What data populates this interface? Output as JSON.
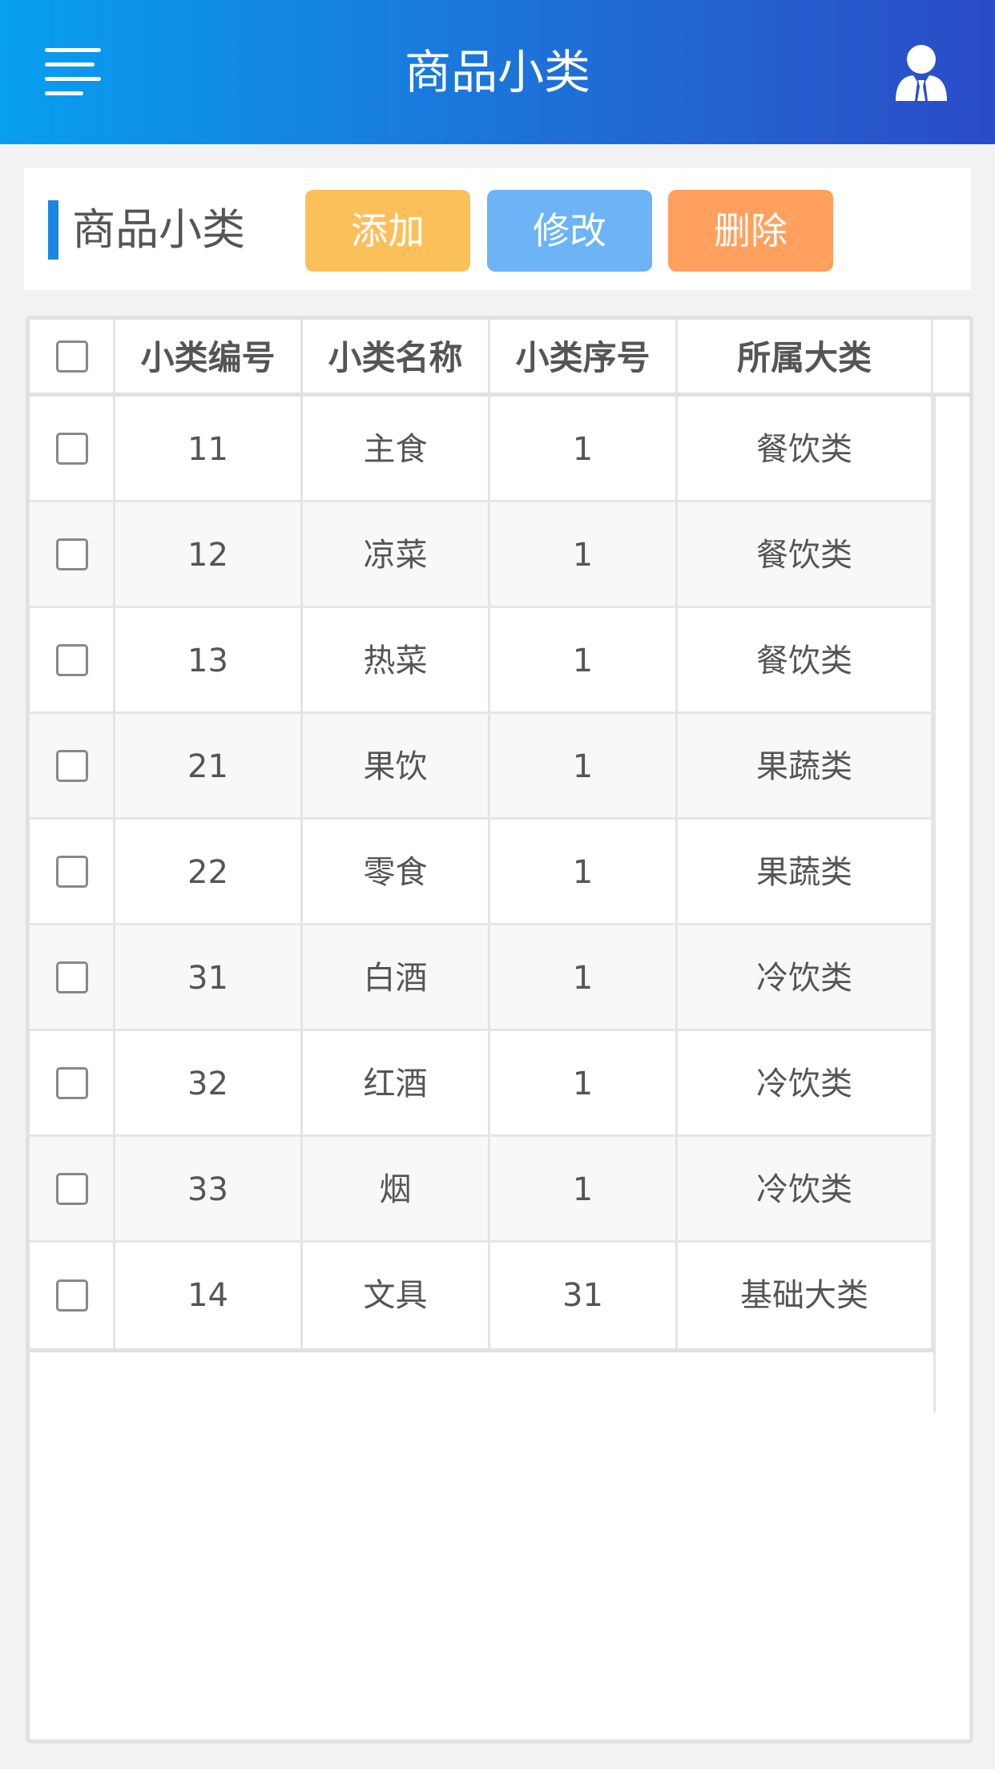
{
  "header": {
    "title": "商品小类",
    "menu_icon": "hamburger-menu-icon",
    "user_icon": "user-profile-icon",
    "gradient": [
      "#079ff0",
      "#2a4cc6"
    ]
  },
  "toolbar": {
    "section_title": "商品小类",
    "add_label": "添加",
    "edit_label": "修改",
    "delete_label": "删除",
    "colors": {
      "add": "#fbc05a",
      "edit": "#6cb4f5",
      "delete": "#ffa05e",
      "accent": "#1a86e8"
    }
  },
  "table": {
    "columns": [
      "小类编号",
      "小类名称",
      "小类序号",
      "所属大类"
    ],
    "rows": [
      {
        "id": "11",
        "name": "主食",
        "order": "1",
        "category": "餐饮类"
      },
      {
        "id": "12",
        "name": "凉菜",
        "order": "1",
        "category": "餐饮类"
      },
      {
        "id": "13",
        "name": "热菜",
        "order": "1",
        "category": "餐饮类"
      },
      {
        "id": "21",
        "name": "果饮",
        "order": "1",
        "category": "果蔬类"
      },
      {
        "id": "22",
        "name": "零食",
        "order": "1",
        "category": "果蔬类"
      },
      {
        "id": "31",
        "name": "白酒",
        "order": "1",
        "category": "冷饮类"
      },
      {
        "id": "32",
        "name": "红酒",
        "order": "1",
        "category": "冷饮类"
      },
      {
        "id": "33",
        "name": "烟",
        "order": "1",
        "category": "冷饮类"
      },
      {
        "id": "14",
        "name": "文具",
        "order": "31",
        "category": "基础大类"
      }
    ]
  }
}
